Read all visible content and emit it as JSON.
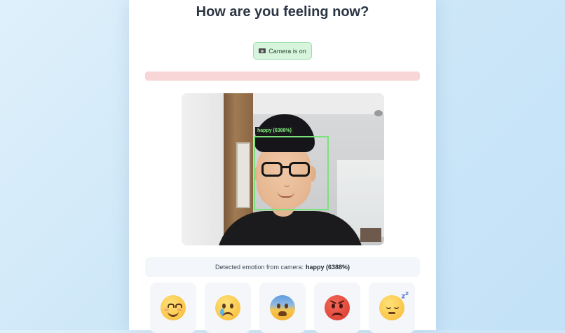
{
  "page": {
    "title": "How are you feeling now?",
    "camera_status": "Camera is on",
    "camera_icon": "video-camera-icon"
  },
  "video": {
    "detection_label": "happy (6388%)"
  },
  "result": {
    "prefix": "Detected emotion from camera:",
    "emotion": "happy (6388%)"
  },
  "emotions": [
    {
      "name": "happy",
      "icon": "smiling-face-emoji"
    },
    {
      "name": "sad",
      "icon": "crying-face-emoji"
    },
    {
      "name": "fearful",
      "icon": "anxious-sweat-face-emoji"
    },
    {
      "name": "angry",
      "icon": "angry-face-emoji"
    },
    {
      "name": "sleepy",
      "icon": "sleeping-face-emoji"
    }
  ],
  "colors": {
    "background": "#cde7f8",
    "badge_bg": "#d6f5dc",
    "error_bar": "#f8d5d6",
    "detection_box": "#7be27b",
    "title_text": "#2b3544"
  }
}
